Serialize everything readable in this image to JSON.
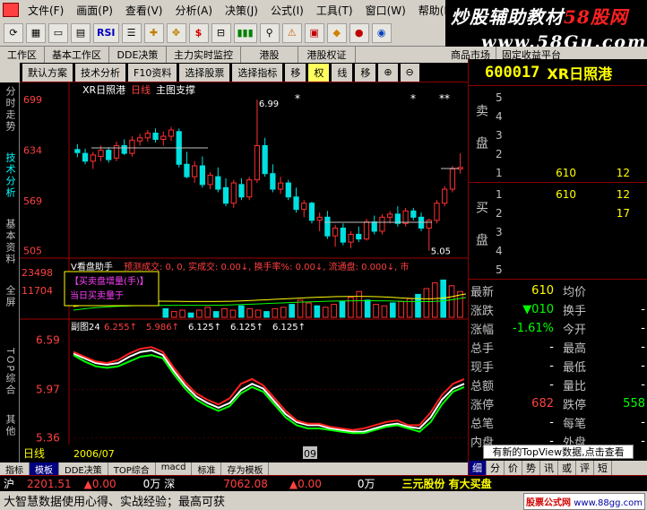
{
  "menu": [
    "文件(F)",
    "画面(P)",
    "查看(V)",
    "分析(A)",
    "决策(J)",
    "公式(I)",
    "工具(T)",
    "窗口(W)",
    "帮助(H)"
  ],
  "brand": {
    "title_a": "炒股辅助教材",
    "title_b": "58股网",
    "url": "www.58Gu.com"
  },
  "toolbar": {
    "rsi": "RSI",
    "dollar": "$"
  },
  "tabrow": [
    "工作区",
    "基本工作区",
    "DDE决策",
    "主力实时监控",
    "港股",
    "港股权证",
    "商品市场",
    "固定收益平台"
  ],
  "subtabs": [
    "默认方案",
    "技术分析",
    "F10资料",
    "选择股票",
    "选择指标",
    "移",
    "权",
    "线",
    "移",
    "⊕",
    "⊖"
  ],
  "sidebar": [
    "分时走势",
    "技术分析",
    "基本资料",
    "全屏",
    "TOP综合",
    "其他"
  ],
  "chart_data": [
    {
      "type": "candlestick",
      "title": "XR日照港",
      "period": "日线",
      "indicator": "主图支撑",
      "yticks": [
        6.99,
        6.34,
        5.69,
        5.05
      ],
      "ylim": [
        5.0,
        7.05
      ],
      "annotations": {
        "high": "6.99",
        "low": "5.05"
      },
      "candles": [
        [
          6.35,
          6.42,
          6.25,
          6.31
        ],
        [
          6.3,
          6.36,
          6.16,
          6.2
        ],
        [
          6.2,
          6.32,
          6.1,
          6.28
        ],
        [
          6.26,
          6.4,
          6.2,
          6.34
        ],
        [
          6.34,
          6.38,
          6.18,
          6.22
        ],
        [
          6.24,
          6.45,
          6.2,
          6.4
        ],
        [
          6.4,
          6.48,
          6.28,
          6.3
        ],
        [
          6.3,
          6.52,
          6.26,
          6.47
        ],
        [
          6.46,
          6.55,
          6.4,
          6.5
        ],
        [
          6.5,
          6.6,
          6.45,
          6.56
        ],
        [
          6.56,
          6.62,
          6.44,
          6.48
        ],
        [
          6.48,
          6.58,
          6.4,
          6.52
        ],
        [
          6.52,
          6.64,
          6.46,
          6.6
        ],
        [
          6.58,
          6.62,
          6.12,
          6.16
        ],
        [
          6.16,
          6.32,
          5.98,
          6.0
        ],
        [
          6.0,
          6.2,
          5.92,
          6.14
        ],
        [
          6.14,
          6.26,
          5.86,
          5.9
        ],
        [
          5.9,
          6.06,
          5.84,
          6.02
        ],
        [
          6.0,
          6.12,
          5.8,
          5.84
        ],
        [
          5.86,
          5.98,
          5.62,
          5.66
        ],
        [
          5.66,
          5.96,
          5.6,
          5.92
        ],
        [
          5.9,
          5.98,
          5.7,
          5.74
        ],
        [
          5.74,
          6.0,
          5.7,
          5.96
        ],
        [
          5.96,
          6.99,
          5.92,
          6.4
        ],
        [
          6.4,
          6.5,
          6.0,
          6.04
        ],
        [
          6.04,
          6.16,
          5.8,
          5.84
        ],
        [
          5.84,
          6.0,
          5.78,
          5.92
        ],
        [
          5.92,
          5.96,
          5.7,
          5.74
        ],
        [
          5.74,
          5.86,
          5.54,
          5.58
        ],
        [
          5.58,
          5.7,
          5.48,
          5.66
        ],
        [
          5.66,
          5.68,
          5.4,
          5.44
        ],
        [
          5.44,
          5.54,
          5.3,
          5.48
        ],
        [
          5.48,
          5.56,
          5.2,
          5.24
        ],
        [
          5.24,
          5.38,
          5.1,
          5.34
        ],
        [
          5.34,
          5.4,
          5.12,
          5.16
        ],
        [
          5.16,
          5.3,
          5.08,
          5.26
        ],
        [
          5.26,
          5.36,
          5.16,
          5.2
        ],
        [
          5.2,
          5.46,
          5.18,
          5.42
        ],
        [
          5.42,
          5.5,
          5.26,
          5.3
        ],
        [
          5.3,
          5.52,
          5.26,
          5.48
        ],
        [
          5.48,
          5.56,
          5.4,
          5.52
        ],
        [
          5.52,
          5.62,
          5.36,
          5.4
        ],
        [
          5.4,
          5.6,
          5.36,
          5.56
        ],
        [
          5.56,
          5.6,
          5.44,
          5.48
        ],
        [
          5.48,
          5.54,
          5.3,
          5.34
        ],
        [
          5.34,
          5.46,
          5.05,
          5.44
        ],
        [
          5.44,
          5.7,
          5.4,
          5.66
        ],
        [
          5.66,
          5.88,
          5.62,
          5.84
        ],
        [
          5.84,
          6.14,
          5.8,
          6.1
        ],
        [
          6.1,
          6.3,
          6.04,
          6.12
        ]
      ]
    },
    {
      "type": "volume",
      "title": "V看盘助手",
      "legend": "预测成交: 0, 0, 实成交: 0.00↓, 换手率%: 0.00↓, 流通盘: 0.000↓, 市",
      "yticks": [
        23498,
        11704
      ],
      "popup": [
        "【买卖盘增量(手)】",
        "当日买卖量于"
      ]
    },
    {
      "type": "line",
      "title": "副图24",
      "legend": [
        "6.255↑",
        "5.986↑",
        "6.125↑",
        "6.125↑",
        "6.125↑"
      ],
      "yticks": [
        6.59,
        5.97,
        5.36
      ],
      "ylim": [
        5.3,
        6.65
      ],
      "series": [
        {
          "color": "#ffffff",
          "values": [
            6.42,
            6.36,
            6.3,
            6.28,
            6.3,
            6.38,
            6.44,
            6.46,
            6.4,
            6.2,
            6.02,
            5.88,
            5.8,
            5.74,
            5.8,
            5.96,
            6.04,
            5.98,
            5.82,
            5.66,
            5.56,
            5.52,
            5.52,
            5.48,
            5.46,
            5.44,
            5.44,
            5.48,
            5.52,
            5.54,
            5.5,
            5.48,
            5.62,
            5.84,
            5.98,
            6.04
          ]
        },
        {
          "color": "#00ff00",
          "values": [
            6.4,
            6.32,
            6.26,
            6.24,
            6.26,
            6.32,
            6.38,
            6.4,
            6.36,
            6.16,
            5.98,
            5.84,
            5.76,
            5.7,
            5.76,
            5.92,
            6.0,
            5.94,
            5.78,
            5.62,
            5.52,
            5.48,
            5.48,
            5.46,
            5.44,
            5.42,
            5.42,
            5.46,
            5.5,
            5.52,
            5.48,
            5.44,
            5.56,
            5.78,
            5.94,
            6.0
          ]
        },
        {
          "color": "#ff2020",
          "values": [
            6.44,
            6.38,
            6.32,
            6.3,
            6.34,
            6.42,
            6.48,
            6.5,
            6.44,
            6.24,
            6.06,
            5.92,
            5.84,
            5.78,
            5.86,
            6.04,
            6.1,
            6.02,
            5.86,
            5.7,
            5.58,
            5.54,
            5.54,
            5.5,
            5.48,
            5.46,
            5.48,
            5.52,
            5.56,
            5.58,
            5.52,
            5.52,
            5.68,
            5.9,
            6.04,
            6.1
          ]
        }
      ],
      "xlabels": [
        "2006/07",
        "09"
      ],
      "period_label": "日线"
    }
  ],
  "bottomtabs": [
    "指标",
    "模板",
    "DDE决策",
    "TOP综合",
    "macd",
    "标准",
    "存为模板"
  ],
  "quote": {
    "code": "600017",
    "name": "XR日照港",
    "sell_label": "卖盘",
    "buy_label": "买盘",
    "sell": [
      {
        "n": "5",
        "p": "",
        "v": ""
      },
      {
        "n": "4",
        "p": "",
        "v": ""
      },
      {
        "n": "3",
        "p": "",
        "v": ""
      },
      {
        "n": "2",
        "p": "",
        "v": ""
      },
      {
        "n": "1",
        "p": "610",
        "v": "12"
      }
    ],
    "buy": [
      {
        "n": "1",
        "p": "610",
        "v": "12"
      },
      {
        "n": "2",
        "p": "",
        "v": "17"
      },
      {
        "n": "3",
        "p": "",
        "v": ""
      },
      {
        "n": "4",
        "p": "",
        "v": ""
      },
      {
        "n": "5",
        "p": "",
        "v": ""
      }
    ],
    "stats": [
      {
        "k": "最新",
        "v": "610",
        "k2": "均价",
        "v2": "",
        "c": "#ffff00"
      },
      {
        "k": "涨跌",
        "v": "▼010",
        "k2": "换手",
        "v2": "-",
        "c": "#00ff00"
      },
      {
        "k": "涨幅",
        "v": "-1.61%",
        "k2": "今开",
        "v2": "-",
        "c": "#00ff00"
      },
      {
        "k": "总手",
        "v": "-",
        "k2": "最高",
        "v2": "-",
        "c": "#ffffff"
      },
      {
        "k": "现手",
        "v": "-",
        "k2": "最低",
        "v2": "-",
        "c": "#ffffff"
      },
      {
        "k": "总额",
        "v": "-",
        "k2": "量比",
        "v2": "-",
        "c": "#ffffff"
      },
      {
        "k": "涨停",
        "v": "682",
        "k2": "跌停",
        "v2": "558",
        "c": "#ff4040"
      },
      {
        "k": "总笔",
        "v": "-",
        "k2": "每笔",
        "v2": "-",
        "c": "#ffffff"
      },
      {
        "k": "内盘",
        "v": "-",
        "k2": "外盘",
        "v2": "-",
        "c": "#ffffff"
      }
    ],
    "notice": "有新的TopView数据,点击查看",
    "tabs": [
      "细",
      "分",
      "价",
      "势",
      "讯",
      "或",
      "评",
      "短"
    ]
  },
  "statusbar": {
    "sh_label": "沪",
    "sh_val": "2201.51",
    "sh_chg": "▲0.00",
    "sh_vol": "0万",
    "sz_label": "深",
    "sz_val": "7062.08",
    "sz_chg": "▲0.00",
    "sz_vol": "0万",
    "news": "三元股份 有大买盘"
  },
  "ticker": {
    "text": "大智慧数据使用心得、实战经验；最高可获",
    "src_a": "股票公式网",
    "src_b": "www.88gg.com"
  }
}
